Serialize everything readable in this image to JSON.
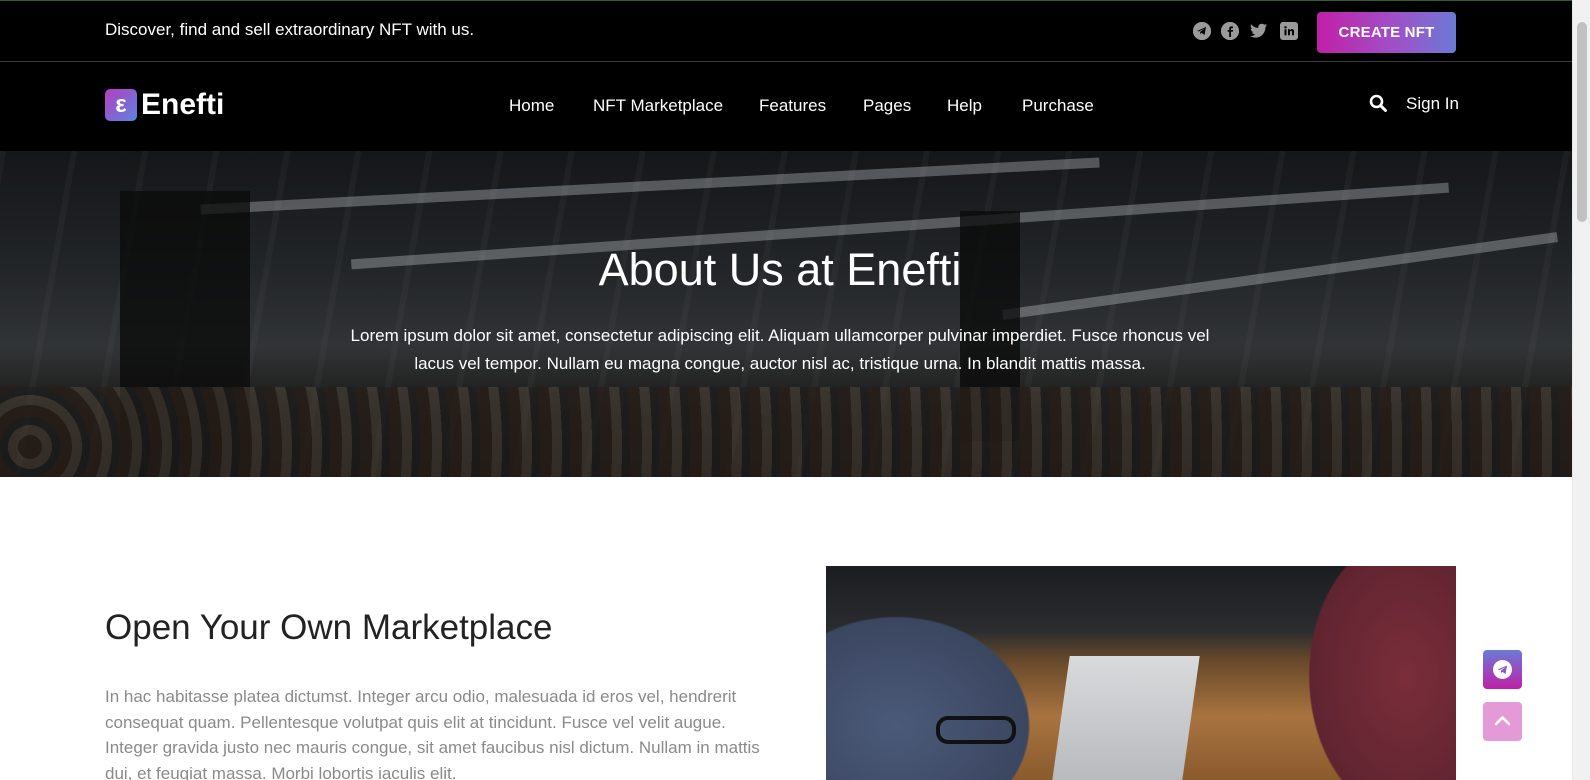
{
  "topbar": {
    "tagline": "Discover, find and sell extraordinary NFT with us.",
    "social_icons": [
      "telegram-icon",
      "facebook-icon",
      "twitter-icon",
      "linkedin-icon"
    ],
    "cta_label": "CREATE NFT"
  },
  "nav": {
    "logo_letter": "ε",
    "logo_text": "Enefti",
    "items": [
      {
        "label": "Home"
      },
      {
        "label": "NFT Marketplace"
      },
      {
        "label": "Features"
      },
      {
        "label": "Pages"
      },
      {
        "label": "Help"
      },
      {
        "label": "Purchase"
      }
    ],
    "search_icon": "search-icon",
    "signin_label": "Sign In"
  },
  "hero": {
    "title": "About Us at Enefti",
    "text": "Lorem ipsum dolor sit amet, consectetur adipiscing elit. Aliquam ullamcorper pulvinar imperdiet. Fusce rhoncus vel lacus vel tempor. Nullam eu magna congue, auctor nisl ac, tristique urna. In blandit mattis massa."
  },
  "section": {
    "title": "Open Your Own Marketplace",
    "text": "In hac habitasse platea dictumst. Integer arcu odio, malesuada id eros vel, hendrerit consequat quam. Pellentesque volutpat quis elit at tincidunt. Fusce vel velit augue. Integer gravida justo nec mauris congue, sit amet faucibus nisl dictum. Nullam in mattis dui, et feugiat massa. Morbi lobortis iaculis elit."
  },
  "floating": {
    "telegram_icon": "telegram-icon",
    "scroll_top_icon": "chevron-up-icon"
  },
  "colors": {
    "accent_start": "#c020a8",
    "accent_end": "#6b7ad6",
    "header_bg": "#000000"
  }
}
